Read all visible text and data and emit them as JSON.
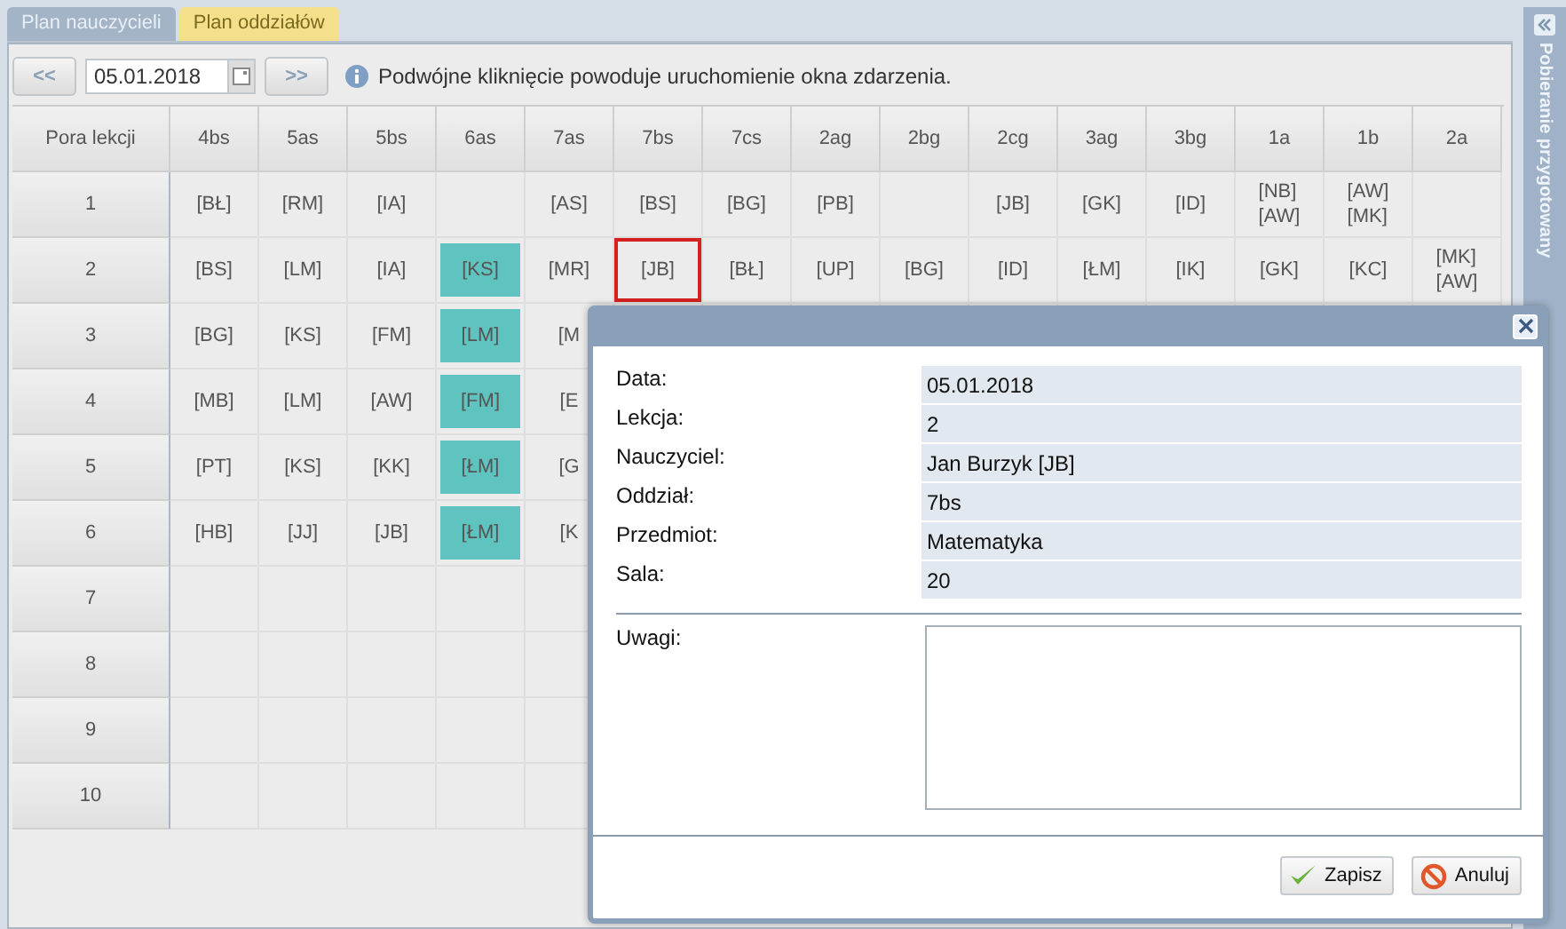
{
  "tabs": [
    {
      "label": "Plan nauczycieli",
      "selected": false
    },
    {
      "label": "Plan oddziałów",
      "selected": true
    }
  ],
  "toolbar": {
    "prev": "<<",
    "date": "05.01.2018",
    "next": ">>",
    "info": "Podwójne kliknięcie powoduje uruchomienie okna zdarzenia."
  },
  "side_panel": {
    "title": "Pobieranie przygotowany"
  },
  "table": {
    "corner": "Pora lekcji",
    "columns": [
      "4bs",
      "5as",
      "5bs",
      "6as",
      "7as",
      "7bs",
      "7cs",
      "2ag",
      "2bg",
      "2cg",
      "3ag",
      "3bg",
      "1a",
      "1b",
      "2a"
    ],
    "rows": [
      {
        "label": "1",
        "cells": [
          {
            "teachers": [
              "[BŁ]"
            ],
            "highlighted": false,
            "selected": false
          },
          {
            "teachers": [
              "[RM]"
            ],
            "highlighted": false,
            "selected": false
          },
          {
            "teachers": [
              "[IA]"
            ],
            "highlighted": false,
            "selected": false
          },
          null,
          {
            "teachers": [
              "[AS]"
            ],
            "highlighted": false,
            "selected": false
          },
          {
            "teachers": [
              "[BS]"
            ],
            "highlighted": false,
            "selected": false
          },
          {
            "teachers": [
              "[BG]"
            ],
            "highlighted": false,
            "selected": false
          },
          {
            "teachers": [
              "[PB]"
            ],
            "highlighted": false,
            "selected": false
          },
          null,
          {
            "teachers": [
              "[JB]"
            ],
            "highlighted": false,
            "selected": false
          },
          {
            "teachers": [
              "[GK]"
            ],
            "highlighted": false,
            "selected": false
          },
          {
            "teachers": [
              "[ID]"
            ],
            "highlighted": false,
            "selected": false
          },
          {
            "teachers": [
              "[NB]",
              "[AW]"
            ],
            "highlighted": false,
            "selected": false
          },
          {
            "teachers": [
              "[AW]",
              "[MK]"
            ],
            "highlighted": false,
            "selected": false
          },
          null
        ]
      },
      {
        "label": "2",
        "cells": [
          {
            "teachers": [
              "[BS]"
            ],
            "highlighted": false,
            "selected": false
          },
          {
            "teachers": [
              "[LM]"
            ],
            "highlighted": false,
            "selected": false
          },
          {
            "teachers": [
              "[IA]"
            ],
            "highlighted": false,
            "selected": false
          },
          {
            "teachers": [
              "[KS]"
            ],
            "highlighted": true,
            "selected": false
          },
          {
            "teachers": [
              "[MR]"
            ],
            "highlighted": false,
            "selected": false
          },
          {
            "teachers": [
              "[JB]"
            ],
            "highlighted": false,
            "selected": true
          },
          {
            "teachers": [
              "[BŁ]"
            ],
            "highlighted": false,
            "selected": false
          },
          {
            "teachers": [
              "[UP]"
            ],
            "highlighted": false,
            "selected": false
          },
          {
            "teachers": [
              "[BG]"
            ],
            "highlighted": false,
            "selected": false
          },
          {
            "teachers": [
              "[ID]"
            ],
            "highlighted": false,
            "selected": false
          },
          {
            "teachers": [
              "[ŁM]"
            ],
            "highlighted": false,
            "selected": false
          },
          {
            "teachers": [
              "[IK]"
            ],
            "highlighted": false,
            "selected": false
          },
          {
            "teachers": [
              "[GK]"
            ],
            "highlighted": false,
            "selected": false
          },
          {
            "teachers": [
              "[KC]"
            ],
            "highlighted": false,
            "selected": false
          },
          {
            "teachers": [
              "[MK]",
              "[AW]"
            ],
            "highlighted": false,
            "selected": false
          }
        ]
      },
      {
        "label": "3",
        "cells": [
          {
            "teachers": [
              "[BG]"
            ],
            "highlighted": false,
            "selected": false
          },
          {
            "teachers": [
              "[KS]"
            ],
            "highlighted": false,
            "selected": false
          },
          {
            "teachers": [
              "[FM]"
            ],
            "highlighted": false,
            "selected": false
          },
          {
            "teachers": [
              "[LM]"
            ],
            "highlighted": true,
            "selected": false
          },
          {
            "teachers": [
              "[M"
            ],
            "highlighted": false,
            "selected": false
          }
        ]
      },
      {
        "label": "4",
        "cells": [
          {
            "teachers": [
              "[MB]"
            ],
            "highlighted": false,
            "selected": false
          },
          {
            "teachers": [
              "[LM]"
            ],
            "highlighted": false,
            "selected": false
          },
          {
            "teachers": [
              "[AW]"
            ],
            "highlighted": false,
            "selected": false
          },
          {
            "teachers": [
              "[FM]"
            ],
            "highlighted": true,
            "selected": false
          },
          {
            "teachers": [
              "[E"
            ],
            "highlighted": false,
            "selected": false
          }
        ]
      },
      {
        "label": "5",
        "cells": [
          {
            "teachers": [
              "[PT]"
            ],
            "highlighted": false,
            "selected": false
          },
          {
            "teachers": [
              "[KS]"
            ],
            "highlighted": false,
            "selected": false
          },
          {
            "teachers": [
              "[KK]"
            ],
            "highlighted": false,
            "selected": false
          },
          {
            "teachers": [
              "[ŁM]"
            ],
            "highlighted": true,
            "selected": false
          },
          {
            "teachers": [
              "[G"
            ],
            "highlighted": false,
            "selected": false
          }
        ]
      },
      {
        "label": "6",
        "cells": [
          {
            "teachers": [
              "[HB]"
            ],
            "highlighted": false,
            "selected": false
          },
          {
            "teachers": [
              "[JJ]"
            ],
            "highlighted": false,
            "selected": false
          },
          {
            "teachers": [
              "[JB]"
            ],
            "highlighted": false,
            "selected": false
          },
          {
            "teachers": [
              "[ŁM]"
            ],
            "highlighted": true,
            "selected": false
          },
          {
            "teachers": [
              "[K"
            ],
            "highlighted": false,
            "selected": false
          }
        ]
      },
      {
        "label": "7"
      },
      {
        "label": "8"
      },
      {
        "label": "9"
      },
      {
        "label": "10"
      }
    ]
  },
  "dialog": {
    "fields": [
      {
        "label": "Data:",
        "value": "05.01.2018"
      },
      {
        "label": "Lekcja:",
        "value": "2"
      },
      {
        "label": "Nauczyciel:",
        "value": "Jan Burzyk [JB]"
      },
      {
        "label": "Oddział:",
        "value": "7bs"
      },
      {
        "label": "Przedmiot:",
        "value": "Matematyka"
      },
      {
        "label": "Sala:",
        "value": "20"
      }
    ],
    "notes_label": "Uwagi:",
    "buttons": [
      {
        "label": "Zapisz",
        "kind": "save"
      },
      {
        "label": "Anuluj",
        "kind": "cancel"
      }
    ]
  }
}
